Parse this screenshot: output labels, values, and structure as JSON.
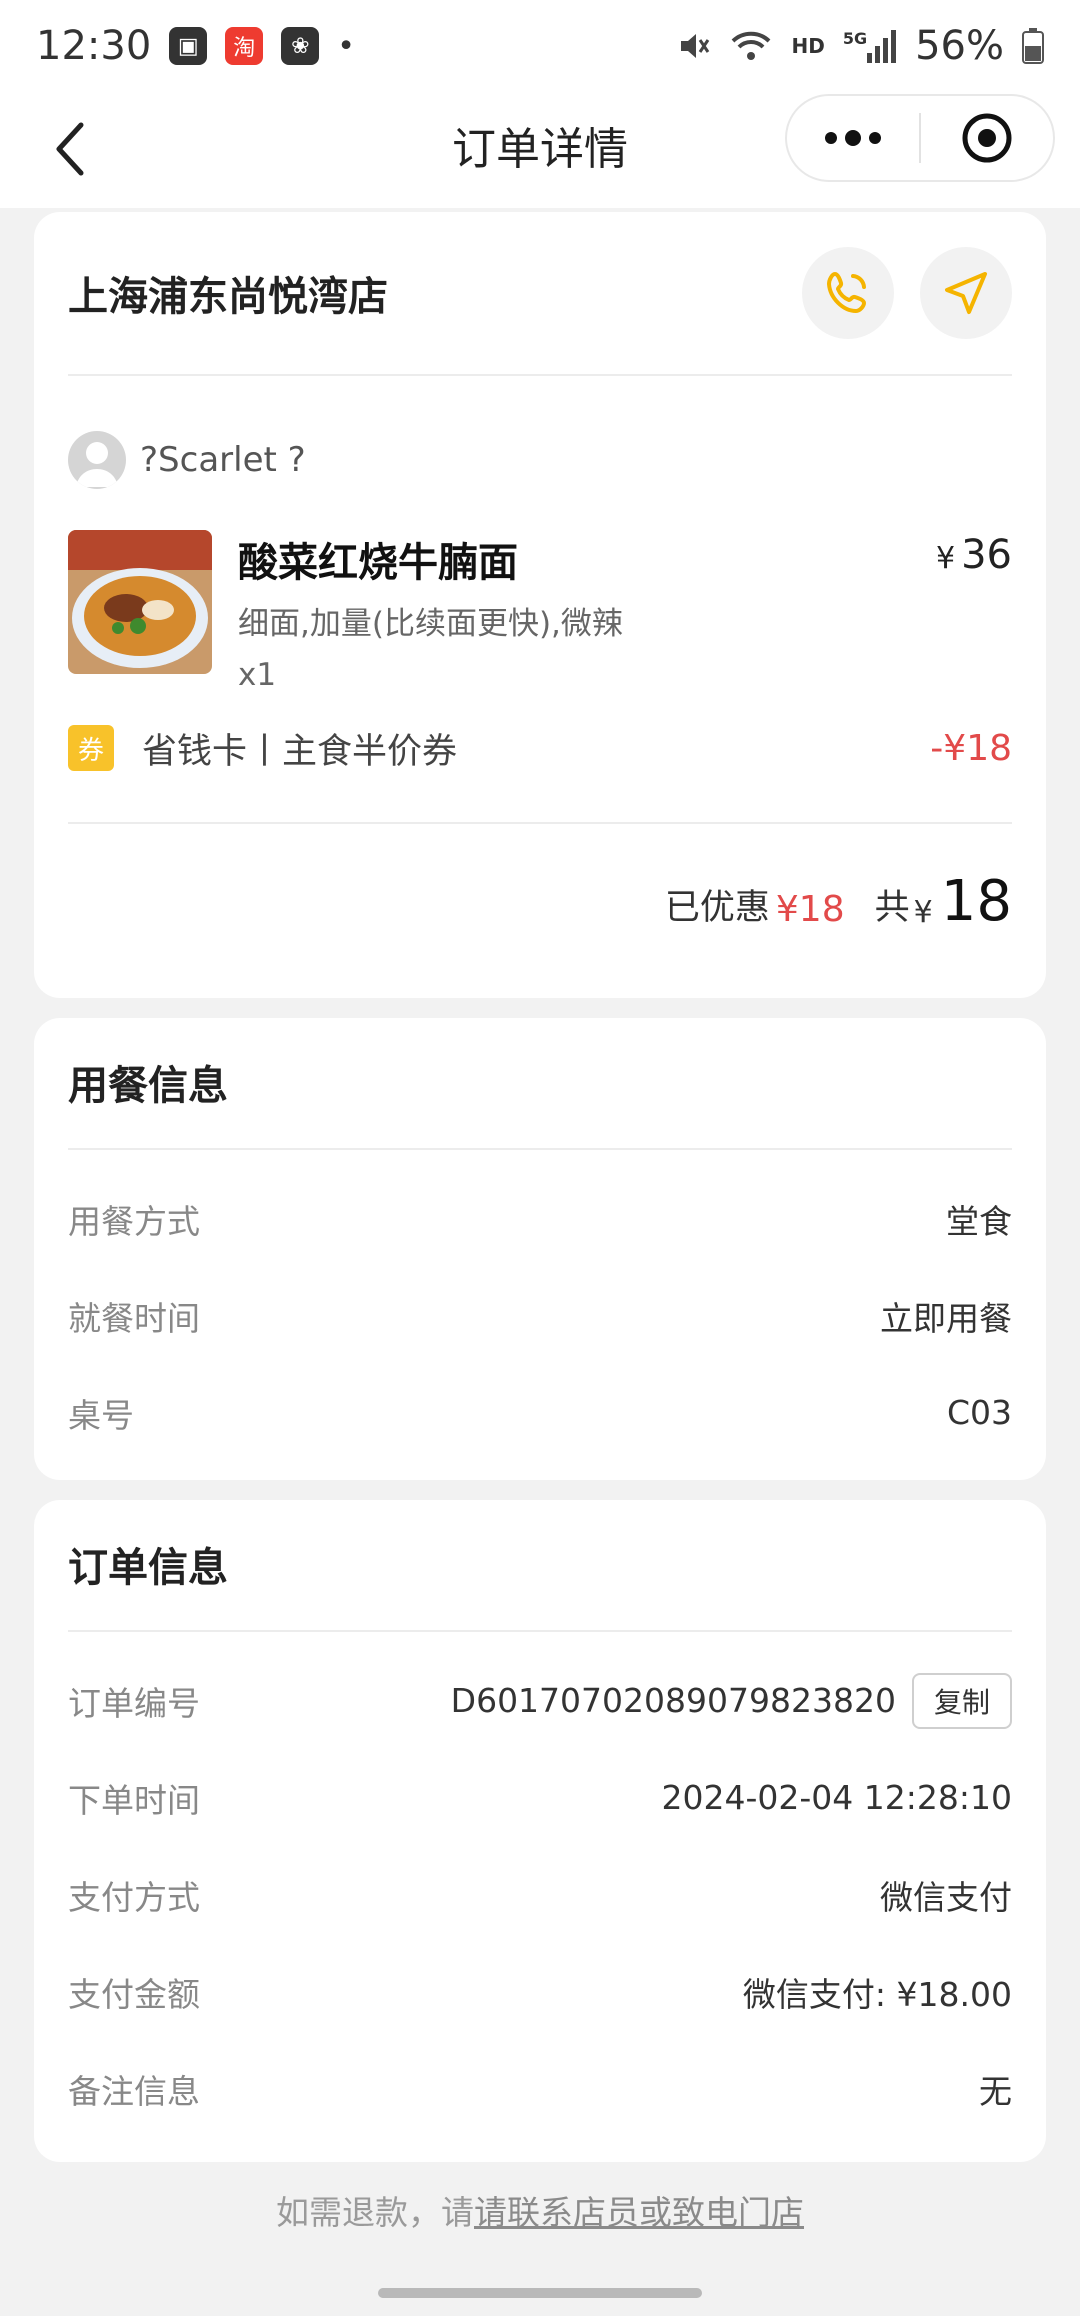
{
  "status_bar": {
    "time": "12:30",
    "battery": "56%",
    "network": "5G",
    "hd": "HD"
  },
  "nav": {
    "title": "订单详情"
  },
  "store": {
    "name": "上海浦东尚悦湾店"
  },
  "order": {
    "user": "?Scarlet ?",
    "item": {
      "name": "酸菜红烧牛腩面",
      "spec": "细面,加量(比续面更快),微辣",
      "qty": "x1",
      "price_symbol": "¥",
      "price": "36"
    },
    "coupon": {
      "tag": "券",
      "text": "省钱卡丨主食半价券",
      "amount": "-¥18"
    },
    "summary": {
      "discount_label": "已优惠",
      "discount_value": "¥18",
      "total_label": "共",
      "total_symbol": "¥",
      "total_value": "18"
    }
  },
  "dining": {
    "title": "用餐信息",
    "rows": [
      {
        "label": "用餐方式",
        "value": "堂食"
      },
      {
        "label": "就餐时间",
        "value": "立即用餐"
      },
      {
        "label": "桌号",
        "value": "C03"
      }
    ]
  },
  "order_info": {
    "title": "订单信息",
    "order_no_label": "订单编号",
    "order_no": "D60170702089079823820",
    "copy_label": "复制",
    "rows": [
      {
        "label": "下单时间",
        "value": "2024-02-04 12:28:10"
      },
      {
        "label": "支付方式",
        "value": "微信支付"
      },
      {
        "label": "支付金额",
        "value": "微信支付: ¥18.00"
      },
      {
        "label": "备注信息",
        "value": "无"
      }
    ]
  },
  "footer": {
    "prefix": "如需退款，请",
    "link": "请联系店员或致电门店"
  },
  "colors": {
    "accent_red": "#e24a4a",
    "coupon_yellow": "#f8c22a",
    "icon_yellow": "#f5b400"
  }
}
